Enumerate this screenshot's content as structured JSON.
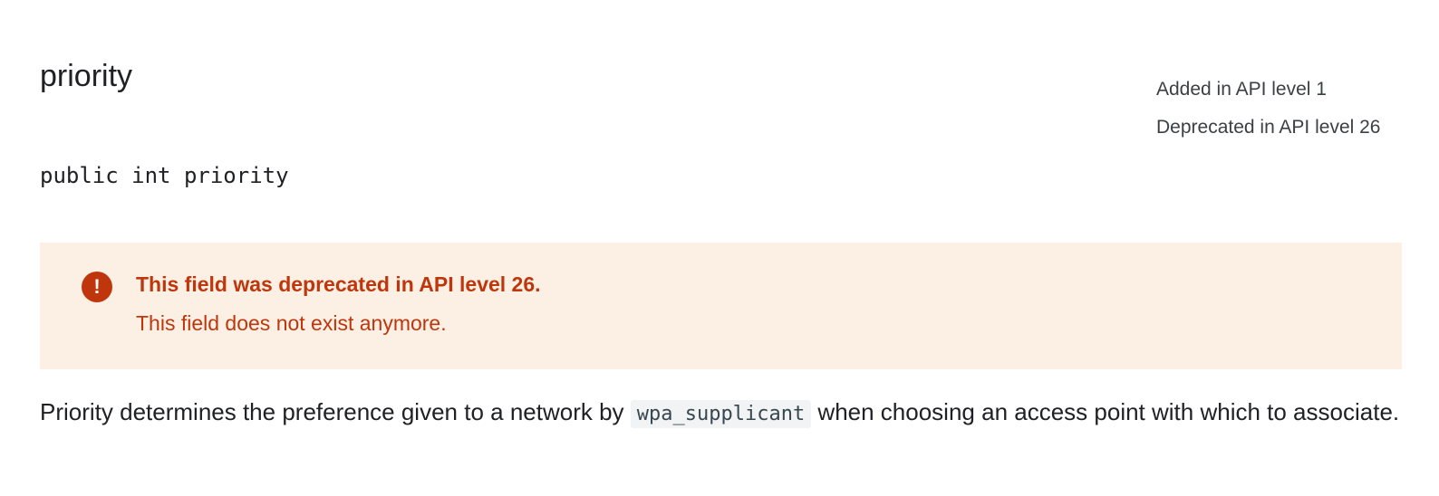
{
  "field": {
    "title": "priority",
    "added": "Added in API level 1",
    "deprecated": "Deprecated in API level 26",
    "signature": "public int priority"
  },
  "caution": {
    "icon": "exclamation-icon",
    "heading": "This field was deprecated in API level 26.",
    "text": "This field does not exist anymore."
  },
  "description": {
    "before": "Priority determines the preference given to a network by ",
    "code": "wpa_supplicant",
    "after": " when choosing an access point with which to associate."
  },
  "colors": {
    "caution_background": "#fcefe3",
    "caution_text": "#bf360c",
    "code_background": "#f1f3f4"
  }
}
